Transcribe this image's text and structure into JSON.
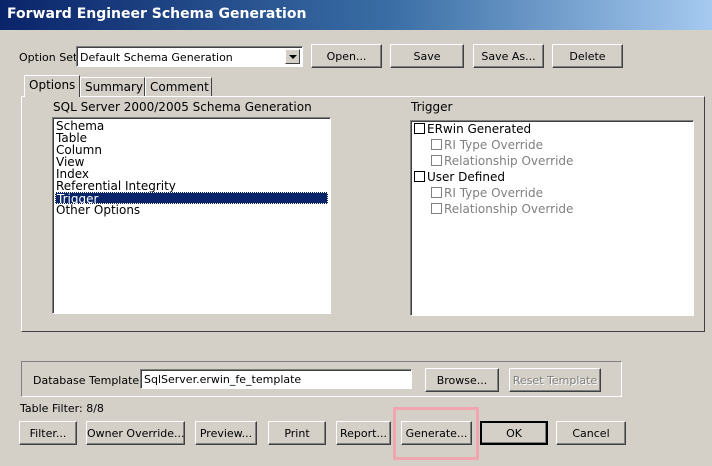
{
  "window": {
    "title": "Forward Engineer Schema Generation"
  },
  "option_set": {
    "label": "Option Set:",
    "value": "Default Schema Generation",
    "buttons": {
      "open": "Open...",
      "save": "Save",
      "save_as": "Save As...",
      "delete": "Delete"
    }
  },
  "tabs": [
    {
      "label": "Options",
      "active": true
    },
    {
      "label": "Summary",
      "active": false
    },
    {
      "label": "Comment",
      "active": false
    }
  ],
  "left_list": {
    "heading": "SQL Server 2000/2005 Schema Generation",
    "items": [
      "Schema",
      "Table",
      "Column",
      "View",
      "Index",
      "Referential Integrity",
      "Trigger",
      "Other Options"
    ],
    "selected": "Trigger"
  },
  "right_tree": {
    "heading": "Trigger",
    "items": [
      {
        "label": "ERwin Generated",
        "checked": false,
        "enabled": true
      },
      {
        "label": "RI Type Override",
        "checked": false,
        "enabled": false
      },
      {
        "label": "Relationship Override",
        "checked": false,
        "enabled": false
      },
      {
        "label": "User Defined",
        "checked": false,
        "enabled": true
      },
      {
        "label": "RI Type Override",
        "checked": false,
        "enabled": false
      },
      {
        "label": "Relationship Override",
        "checked": false,
        "enabled": false
      }
    ]
  },
  "template": {
    "label": "Database Template:",
    "value": "SqlServer.erwin_fe_template",
    "browse": "Browse...",
    "reset": "Reset Template"
  },
  "table_filter": "Table Filter: 8/8",
  "bottom_buttons": {
    "filter": "Filter...",
    "owner_override": "Owner Override...",
    "preview": "Preview...",
    "print": "Print",
    "report": "Report...",
    "generate": "Generate...",
    "ok": "OK",
    "cancel": "Cancel"
  }
}
